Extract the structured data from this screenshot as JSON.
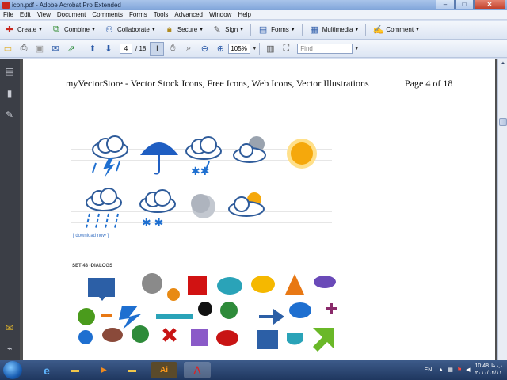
{
  "window": {
    "title": "icon.pdf - Adobe Acrobat Pro Extended",
    "minimize": "–",
    "maximize": "□",
    "close": "✕"
  },
  "menu": [
    "File",
    "Edit",
    "View",
    "Document",
    "Comments",
    "Forms",
    "Tools",
    "Advanced",
    "Window",
    "Help"
  ],
  "tasks": {
    "create": "Create",
    "combine": "Combine",
    "collaborate": "Collaborate",
    "secure": "Secure",
    "sign": "Sign",
    "forms": "Forms",
    "multimedia": "Multimedia",
    "comment": "Comment"
  },
  "nav": {
    "page": "4",
    "total": "/ 18",
    "zoom": "105%",
    "find_placeholder": "Find"
  },
  "page": {
    "header": "myVectorStore - Vector Stock Icons, Free Icons, Web Icons, Vector Illustrations",
    "page_label": "Page 4 of 18",
    "download_link": "[ download now ]",
    "set_title": "SET 48 -DIALOGS"
  },
  "taskbar": {
    "lang": "EN",
    "time": "10:48 ب.ظ",
    "date": "۲۰۱۰/۱۲/۱۱"
  },
  "colors": {
    "accent": "#2b5aa8",
    "title_bar": "#7fa4d9",
    "close_button": "#c2412c"
  }
}
